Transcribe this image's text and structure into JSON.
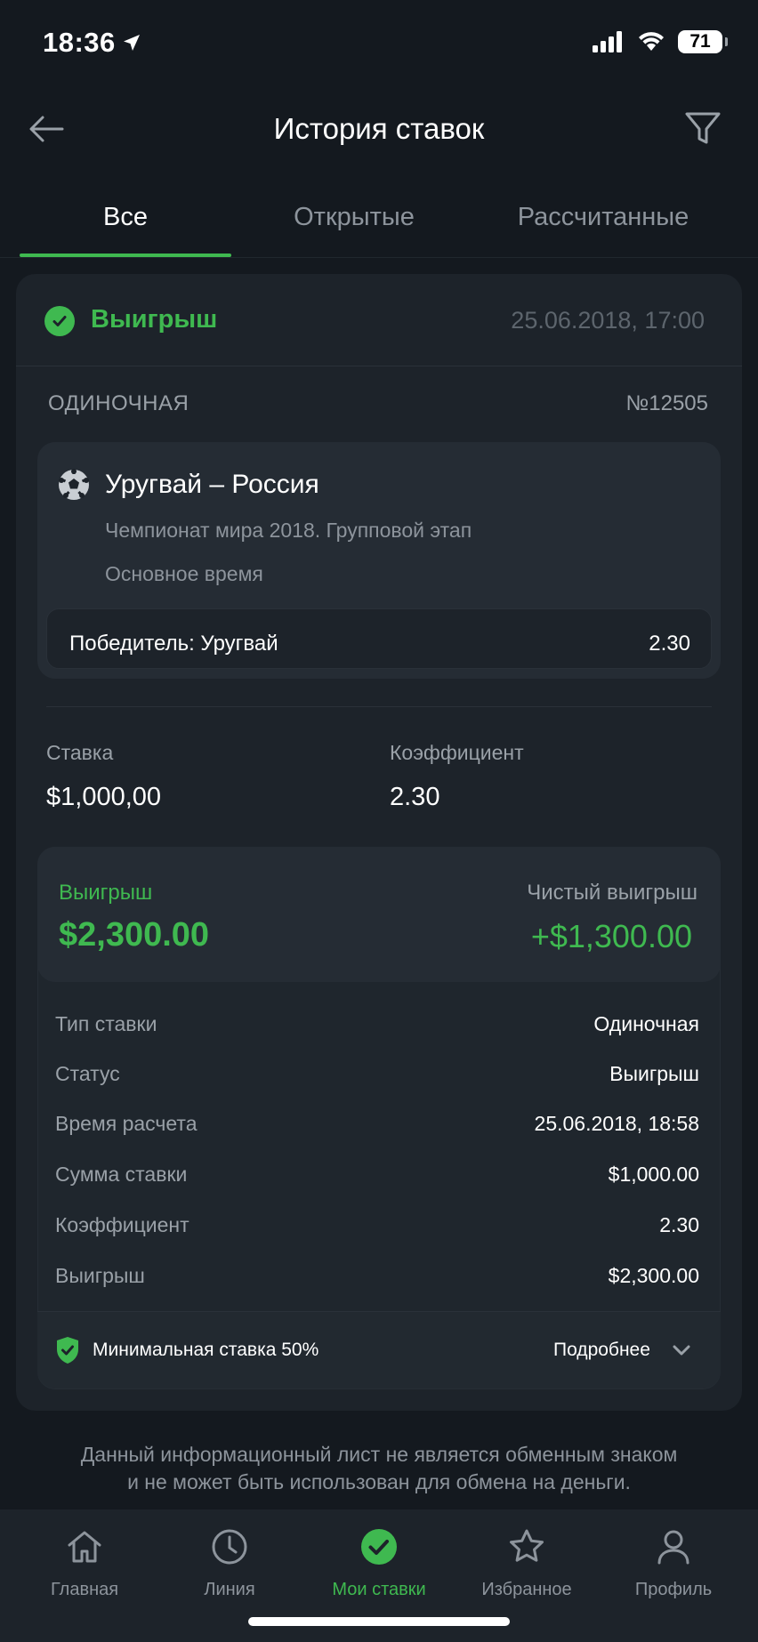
{
  "status_bar": {
    "time": "18:36",
    "battery": "71"
  },
  "header": {
    "title": "История ставок"
  },
  "tabs": [
    {
      "label": "Все",
      "active": true
    },
    {
      "label": "Открытые",
      "active": false
    },
    {
      "label": "Рассчитанные",
      "active": false
    }
  ],
  "bet": {
    "result": "Выигрыш",
    "date": "25.06.2018, 17:00",
    "type": "ОДИНОЧНАЯ",
    "number": "№12505",
    "event": {
      "title": "Уругвай – Россия",
      "league": "Чемпионат мира 2018. Групповой этап",
      "period": "Основное время",
      "selection": "Победитель: Уругвай",
      "odds": "2.30"
    },
    "stake_label": "Ставка",
    "stake_value": "$1,000,00",
    "coef_label": "Коэффициент",
    "coef_value": "2.30",
    "payout_label": "Выигрыш",
    "payout_value": "$2,300.00",
    "net_label": "Чистый выигрыш",
    "net_value": "+$1,300.00",
    "details": [
      {
        "label": "Тип ставки",
        "value": "Одиночная"
      },
      {
        "label": "Статус",
        "value": "Выигрыш"
      },
      {
        "label": "Время расчета",
        "value": "25.06.2018, 18:58"
      },
      {
        "label": "Сумма ставки",
        "value": "$1,000.00"
      },
      {
        "label": "Коэффициент",
        "value": "2.30"
      },
      {
        "label": "Выигрыш",
        "value": "$2,300.00"
      }
    ],
    "min_stake": "Минимальная ставка 50%",
    "more": "Подробнее"
  },
  "disclaimer": {
    "line1": "Данный информационный лист не является обменным знаком",
    "line2": "и не может быть использован для обмена на деньги."
  },
  "nav": [
    {
      "label": "Главная",
      "icon": "home-icon"
    },
    {
      "label": "Линия",
      "icon": "clock-icon"
    },
    {
      "label": "Мои ставки",
      "icon": "check-circle-icon",
      "active": true
    },
    {
      "label": "Избранное",
      "icon": "star-icon"
    },
    {
      "label": "Профиль",
      "icon": "user-icon"
    }
  ],
  "colors": {
    "accent": "#3fb950",
    "background": "#14191f",
    "card": "#1d232a"
  }
}
